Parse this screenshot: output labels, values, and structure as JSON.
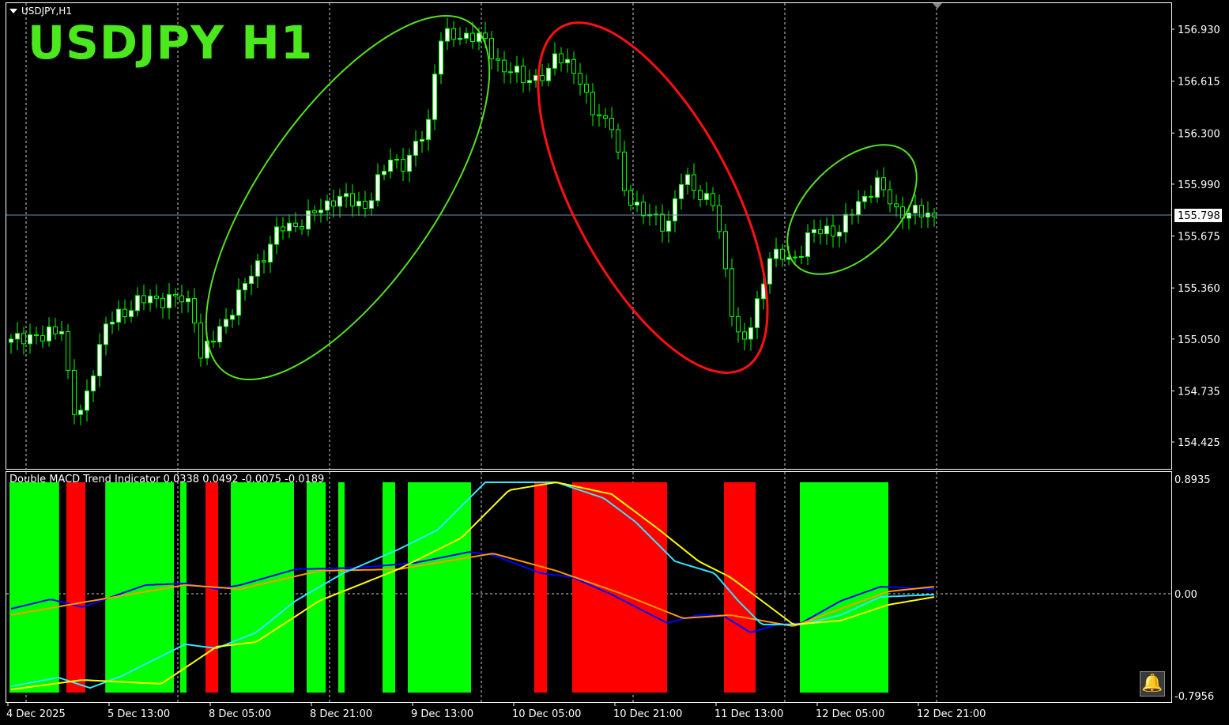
{
  "symbol_label": "USDJPY,H1",
  "watermark": "USDJPY  H1",
  "indicator_label": "Double MACD Trend Indicator 0.0338 0.0492 -0.0075 -0.0189",
  "colors": {
    "bg": "#000000",
    "candle": "#00ff00",
    "bull_body": "#ffffff",
    "bear_body": "#000000",
    "green_zone": "#00ff00",
    "red_zone": "#ff0000",
    "blue": "#0000ff",
    "orange": "#ff9900",
    "cyan": "#33e6ff",
    "yellow": "#ffff00",
    "ellipse_green": "#55e01e",
    "ellipse_red": "#ff1010",
    "price_line": "#6f8fb0"
  },
  "chart_data": [
    {
      "type": "candlestick",
      "title": "USDJPY, H1",
      "current_price": "155.798",
      "price_ticks": [
        "156.930",
        "156.615",
        "156.300",
        "155.990",
        "155.675",
        "155.360",
        "155.050",
        "154.735",
        "154.425"
      ],
      "ylim": [
        154.3,
        157.07
      ],
      "bars": 147,
      "time_labels": [
        "4 Dec 2025",
        "5 Dec 13:00",
        "8 Dec 05:00",
        "8 Dec 21:00",
        "9 Dec 13:00",
        "10 Dec 05:00",
        "10 Dec 21:00",
        "11 Dec 13:00",
        "12 Dec 05:00",
        "12 Dec 21:00"
      ],
      "close_keyframes": [
        [
          0,
          155.03
        ],
        [
          2.5,
          155.08
        ],
        [
          5,
          155.05
        ],
        [
          8,
          155.13
        ],
        [
          9.75,
          154.61
        ],
        [
          11.25,
          154.59
        ],
        [
          13,
          154.88
        ],
        [
          15,
          155.13
        ],
        [
          20,
          155.28
        ],
        [
          26,
          155.3
        ],
        [
          28.75,
          155.25
        ],
        [
          30,
          154.95
        ],
        [
          32.5,
          155.07
        ],
        [
          36.25,
          155.33
        ],
        [
          42.5,
          155.72
        ],
        [
          46.25,
          155.76
        ],
        [
          51.25,
          155.91
        ],
        [
          56.25,
          155.86
        ],
        [
          60,
          156.15
        ],
        [
          62.5,
          156.1
        ],
        [
          66.25,
          156.39
        ],
        [
          67.5,
          156.87
        ],
        [
          72.5,
          156.9
        ],
        [
          75,
          156.85
        ],
        [
          77.5,
          156.7
        ],
        [
          81.25,
          156.63
        ],
        [
          85,
          156.65
        ],
        [
          86.25,
          156.8
        ],
        [
          88.75,
          156.7
        ],
        [
          91.25,
          156.48
        ],
        [
          95,
          156.34
        ],
        [
          96.9,
          155.96
        ],
        [
          100,
          155.81
        ],
        [
          103.75,
          155.74
        ],
        [
          106.25,
          156.03
        ],
        [
          111.25,
          155.86
        ],
        [
          113.75,
          155.28
        ],
        [
          115.6,
          154.99
        ],
        [
          117.5,
          155.18
        ],
        [
          120,
          155.57
        ],
        [
          123.75,
          155.52
        ],
        [
          126.25,
          155.69
        ],
        [
          131.25,
          155.72
        ],
        [
          133.75,
          155.86
        ],
        [
          136.9,
          156.0
        ],
        [
          140,
          155.83
        ],
        [
          146,
          155.8
        ]
      ],
      "annotations": [
        {
          "shape": "ellipse",
          "color": "green",
          "span_bars": [
            32,
            75
          ]
        },
        {
          "shape": "ellipse",
          "color": "red",
          "span_bars": [
            85,
            118
          ]
        },
        {
          "shape": "ellipse",
          "color": "green",
          "span_bars": [
            124,
            142
          ]
        }
      ]
    },
    {
      "type": "line",
      "title": "Double MACD Trend Indicator",
      "ylim": [
        -0.7956,
        0.8935
      ],
      "y_ticks": [
        "0.8935",
        "0.00",
        "-0.7956"
      ],
      "zones": {
        "green": [
          [
            0.25,
            8.1
          ],
          [
            15.4,
            26.25
          ],
          [
            27.25,
            28.25
          ],
          [
            35.25,
            45.25
          ],
          [
            47.25,
            50.25
          ],
          [
            52.25,
            53.25
          ],
          [
            59.25,
            61.25
          ],
          [
            63.25,
            73.25
          ],
          [
            125.25,
            139.25
          ]
        ],
        "red": [
          [
            9.25,
            12.25
          ],
          [
            31.25,
            33.25
          ],
          [
            83.25,
            85.25
          ],
          [
            89.25,
            104.25
          ],
          [
            113.25,
            118.25
          ]
        ]
      },
      "series": [
        {
          "name": "blue",
          "points": [
            [
              0,
              -0.117
            ],
            [
              6.25,
              -0.043
            ],
            [
              11.25,
              -0.105
            ],
            [
              21.25,
              0.068
            ],
            [
              27.5,
              0.08
            ],
            [
              32.5,
              0.037
            ],
            [
              36.25,
              0.068
            ],
            [
              45,
              0.191
            ],
            [
              55,
              0.203
            ],
            [
              63.75,
              0.24
            ],
            [
              72.5,
              0.326
            ],
            [
              76.25,
              0.302
            ],
            [
              83.75,
              0.16
            ],
            [
              88.75,
              0.129
            ],
            [
              95,
              -0.006
            ],
            [
              103.75,
              -0.228
            ],
            [
              108.75,
              -0.166
            ],
            [
              112.5,
              -0.166
            ],
            [
              116.9,
              -0.302
            ],
            [
              121.25,
              -0.24
            ],
            [
              125,
              -0.228
            ],
            [
              131.25,
              -0.055
            ],
            [
              137.5,
              0.055
            ],
            [
              146,
              0.037
            ]
          ]
        },
        {
          "name": "orange",
          "points": [
            [
              0,
              -0.166
            ],
            [
              11.25,
              -0.068
            ],
            [
              27.5,
              0.068
            ],
            [
              36.25,
              0.037
            ],
            [
              48.75,
              0.179
            ],
            [
              61.25,
              0.191
            ],
            [
              76.25,
              0.314
            ],
            [
              86.25,
              0.179
            ],
            [
              96.25,
              0.006
            ],
            [
              106.25,
              -0.191
            ],
            [
              113.75,
              -0.166
            ],
            [
              123.75,
              -0.253
            ],
            [
              131.25,
              -0.117
            ],
            [
              138.75,
              0.018
            ],
            [
              146,
              0.055
            ]
          ]
        },
        {
          "name": "cyan",
          "points": [
            [
              0,
              -0.721
            ],
            [
              7.5,
              -0.653
            ],
            [
              12.5,
              -0.734
            ],
            [
              17.5,
              -0.641
            ],
            [
              27.5,
              -0.394
            ],
            [
              32.5,
              -0.425
            ],
            [
              38.75,
              -0.302
            ],
            [
              45,
              -0.055
            ],
            [
              52.5,
              0.16
            ],
            [
              61.25,
              0.345
            ],
            [
              67.5,
              0.499
            ],
            [
              75,
              0.869
            ],
            [
              86.25,
              0.869
            ],
            [
              93.75,
              0.745
            ],
            [
              98.75,
              0.561
            ],
            [
              105,
              0.253
            ],
            [
              111.25,
              0.16
            ],
            [
              115,
              -0.055
            ],
            [
              118.75,
              -0.24
            ],
            [
              125,
              -0.24
            ],
            [
              131.25,
              -0.166
            ],
            [
              137.5,
              -0.025
            ],
            [
              146,
              -0.006
            ]
          ]
        },
        {
          "name": "yellow",
          "points": [
            [
              0,
              -0.746
            ],
            [
              11.25,
              -0.672
            ],
            [
              23.75,
              -0.702
            ],
            [
              32.5,
              -0.413
            ],
            [
              38.75,
              -0.376
            ],
            [
              48.75,
              -0.055
            ],
            [
              61.25,
              0.191
            ],
            [
              71.25,
              0.437
            ],
            [
              78.75,
              0.807
            ],
            [
              86.25,
              0.869
            ],
            [
              95,
              0.776
            ],
            [
              102.5,
              0.499
            ],
            [
              108.75,
              0.253
            ],
            [
              113.75,
              0.129
            ],
            [
              123.75,
              -0.24
            ],
            [
              131.25,
              -0.209
            ],
            [
              138.75,
              -0.086
            ],
            [
              146,
              -0.025
            ]
          ]
        }
      ]
    }
  ]
}
